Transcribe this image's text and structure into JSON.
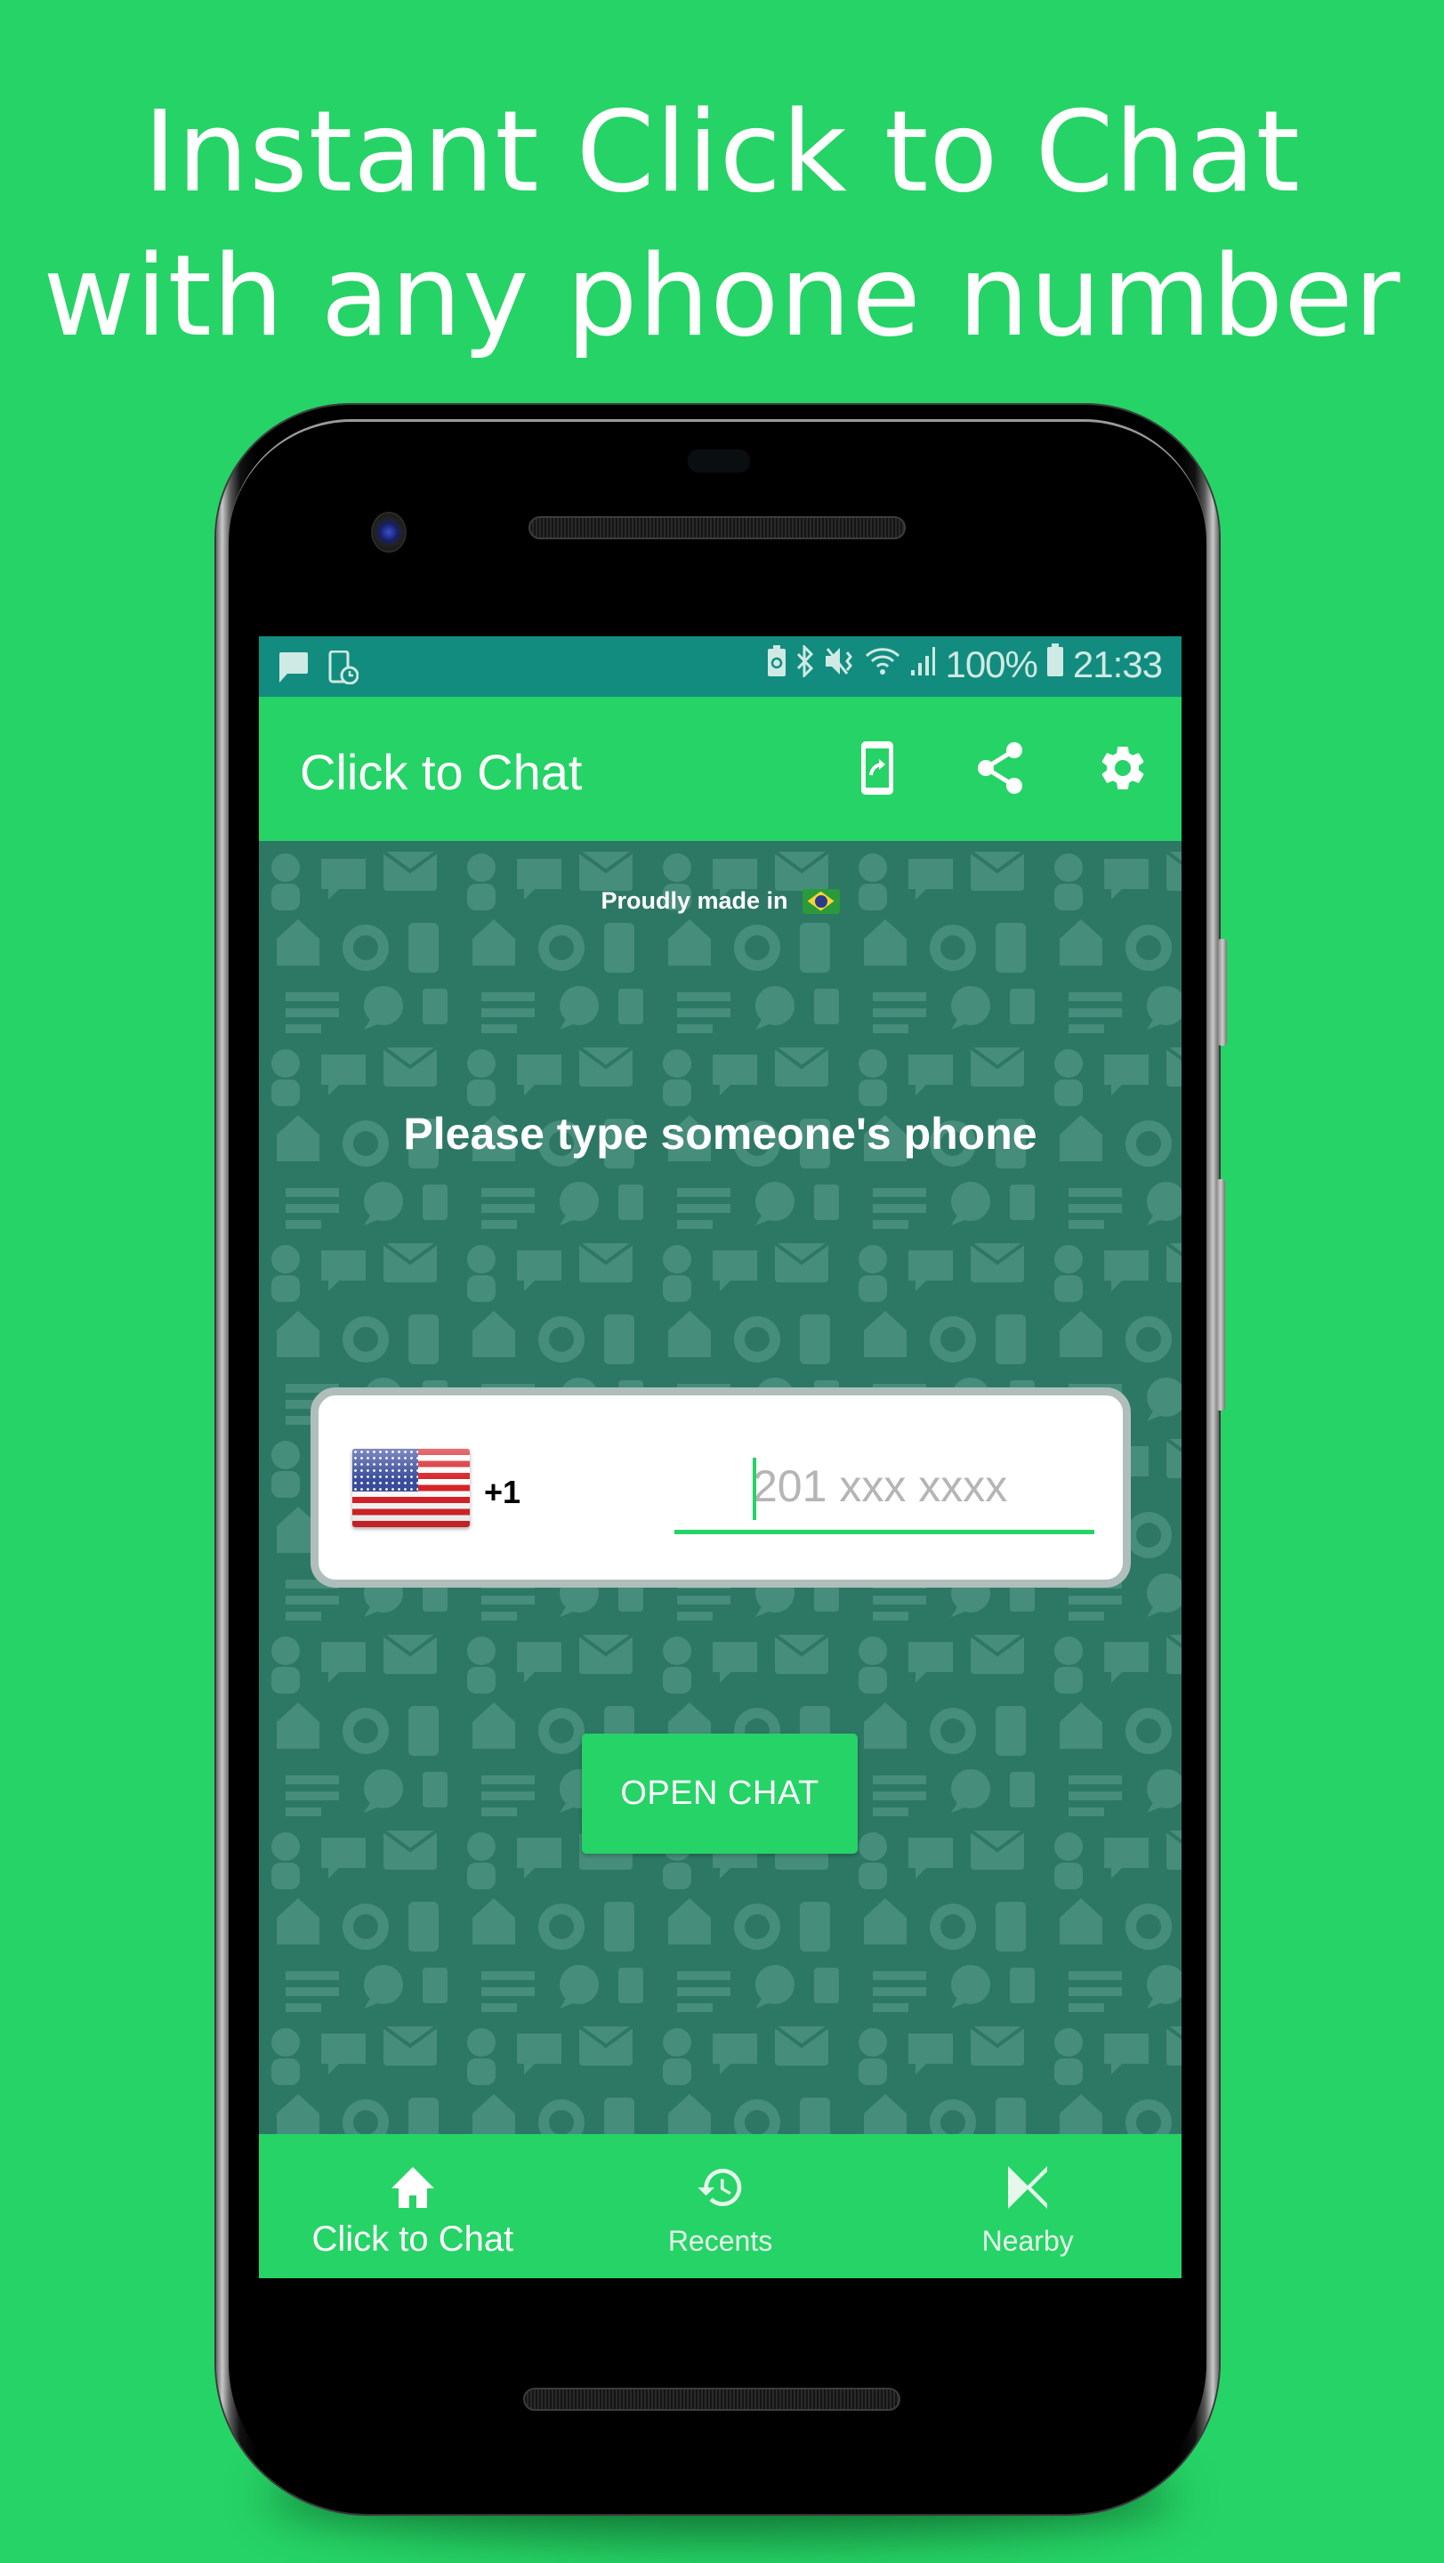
{
  "headline": {
    "line1": "Instant Click to Chat",
    "line2": "with any phone number"
  },
  "colors": {
    "brand_green": "#26d366",
    "status_bar_teal": "#128c7e",
    "content_bg": "#2d7765",
    "underline_green": "#26d366"
  },
  "status_bar": {
    "left_icons": [
      "message-icon",
      "phone-clock-icon"
    ],
    "right_icons": [
      "battery-saver-icon",
      "bluetooth-icon",
      "mute-vibrate-icon",
      "wifi-icon",
      "signal-icon"
    ],
    "battery_percent": "100%",
    "time": "21:33"
  },
  "app_bar": {
    "title": "Click to Chat",
    "actions": [
      {
        "name": "open-in-phone",
        "icon": "phone-forward-icon"
      },
      {
        "name": "share",
        "icon": "share-icon"
      },
      {
        "name": "settings",
        "icon": "gear-icon"
      }
    ]
  },
  "content": {
    "made_in_label": "Proudly made in",
    "made_in_flag": "brazil-flag",
    "prompt": "Please type someone's phone",
    "country_flag": "usa-flag",
    "dial_code": "+1",
    "phone_input": {
      "value": "",
      "placeholder": "201 xxx xxxx"
    },
    "open_chat_label": "OPEN CHAT"
  },
  "bottom_nav": {
    "items": [
      {
        "label": "Click to Chat",
        "icon": "home-icon",
        "active": true
      },
      {
        "label": "Recents",
        "icon": "history-icon",
        "active": false
      },
      {
        "label": "Nearby",
        "icon": "nearby-icon",
        "active": false
      }
    ]
  }
}
